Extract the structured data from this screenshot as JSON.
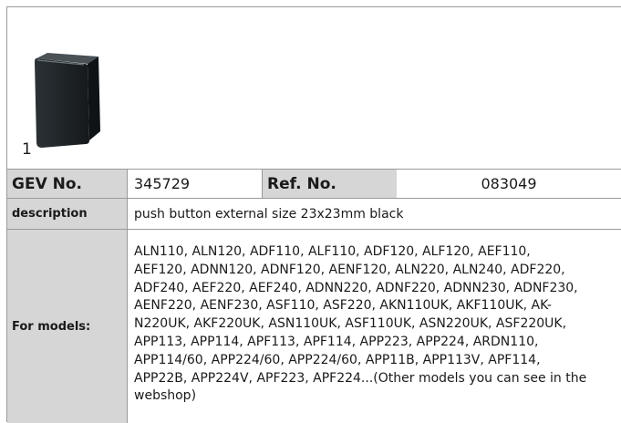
{
  "figure": {
    "number": "1",
    "icon": "black-push-button-cap"
  },
  "table": {
    "gev_label": "GEV No.",
    "gev_value": "345729",
    "ref_label": "Ref. No.",
    "ref_value": "083049",
    "description_label": "description",
    "description_value": "push button  external size 23x23mm black",
    "models_label": "For models:",
    "models_value": "ALN110, ALN120, ADF110, ALF110, ADF120, ALF120, AEF110,\nAEF120, ADNN120, ADNF120, AENF120, ALN220, ALN240, ADF220,\nADF240, AEF220, AEF240, ADNN220, ADNF220, ADNN230, ADNF230,\nAENF220, AENF230, ASF110, ASF220, AKN110UK, AKF110UK, AK-\nN220UK, AKF220UK, ASN110UK, ASF110UK, ASN220UK, ASF220UK,\nAPP113, APP114, APF113, APF114, APP223, APP224, ARDN110,\nAPP114/60, APP224/60, APP224/60, APP11B, APP113V, APF114,\nAPP22B, APP224V, APF223, APF224...(Other models you can see in the\nwebshop)"
  },
  "colors": {
    "label_bg": "#d6d6d6",
    "border": "#9a9a9a",
    "product": "#1e2326"
  }
}
